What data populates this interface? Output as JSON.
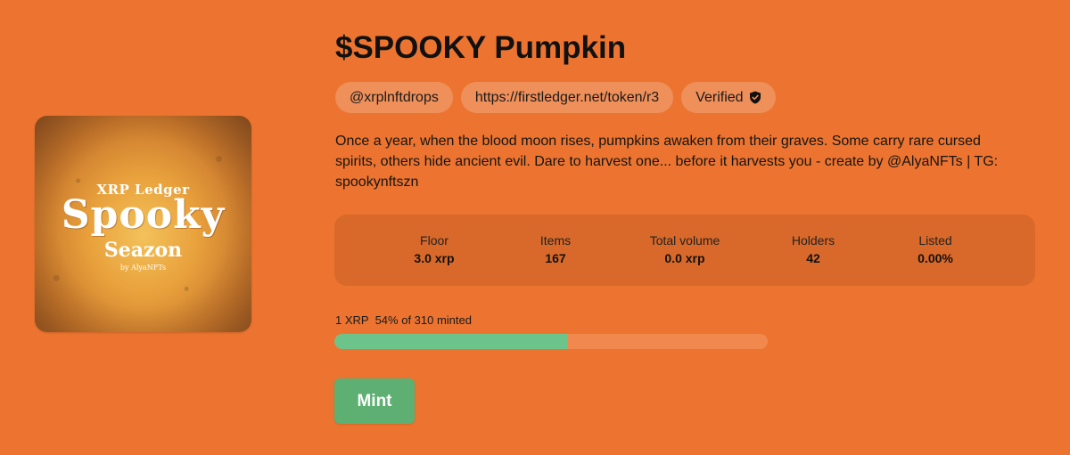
{
  "collection": {
    "title": "$SPOOKY Pumpkin",
    "image": {
      "line1": "XRP Ledger",
      "line2": "Spooky",
      "line3": "Seazon",
      "line4": "by AlyaNFTs"
    },
    "pills": {
      "handle": "@xrplnftdrops",
      "link": "https://firstledger.net/token/r3",
      "verified": "Verified",
      "verified_icon": "shield-check-icon"
    },
    "description": "Once a year, when the blood moon rises, pumpkins awaken from their graves. Some carry rare cursed spirits, others hide ancient evil. Dare to harvest one... before it harvests you - create by @AlyaNFTs | TG: spookynftszn"
  },
  "stats": [
    {
      "label": "Floor",
      "value": "3.0 xrp"
    },
    {
      "label": "Items",
      "value": "167"
    },
    {
      "label": "Total volume",
      "value": "0.0 xrp"
    },
    {
      "label": "Holders",
      "value": "42"
    },
    {
      "label": "Listed",
      "value": "0.00%"
    }
  ],
  "mint": {
    "price": "1 XRP",
    "progress_text": "54% of 310 minted",
    "progress_fraction": 0.54,
    "button_label": "Mint"
  },
  "colors": {
    "background": "#EC7430",
    "stats_panel": "#D9692A",
    "progress_fill": "#6CC48B",
    "mint_button": "#5EAF72"
  }
}
